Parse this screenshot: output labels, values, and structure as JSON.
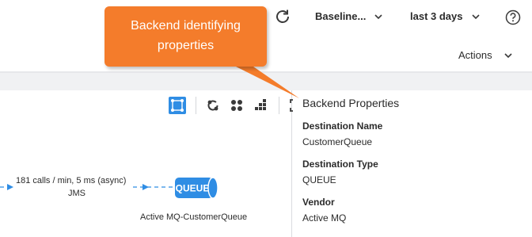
{
  "header": {
    "baseline_dropdown": "Baseline...",
    "range_dropdown": "last 3 days",
    "actions_label": "Actions"
  },
  "graph": {
    "edge_label": "181 calls / min, 5 ms (async)",
    "edge_sublabel": "JMS",
    "node_label": "Active MQ-CustomerQueue",
    "node_badge": "QUEUE"
  },
  "properties": {
    "title": "Backend Properties",
    "items": [
      {
        "name": "Destination Name",
        "value": "CustomerQueue"
      },
      {
        "name": "Destination Type",
        "value": "QUEUE"
      },
      {
        "name": "Vendor",
        "value": "Active MQ"
      }
    ]
  },
  "callout": {
    "line1": "Backend identifying",
    "line2": "properties"
  },
  "colors": {
    "accent": "#2f8de4",
    "callout": "#f47c2b",
    "text": "#2b2b2b"
  },
  "icons": [
    "refresh-icon",
    "chevron-down-icon",
    "help-icon",
    "focus-icon",
    "recenter-icon",
    "grid-icon",
    "layout-icon",
    "fullscreen-icon",
    "queue-icon"
  ]
}
